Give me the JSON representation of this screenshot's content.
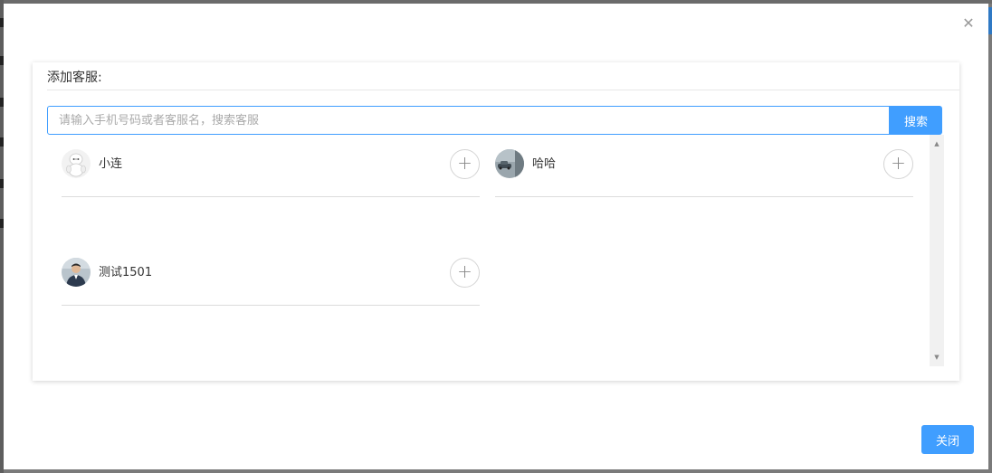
{
  "dialog": {
    "close_icon": "close-icon",
    "panel_title": "添加客服:",
    "search": {
      "placeholder": "请输入手机号码或者客服名，搜索客服",
      "value": "",
      "button_label": "搜索"
    },
    "agents": [
      {
        "name": "小连",
        "avatar": "robot-avatar",
        "add_icon": "plus-icon"
      },
      {
        "name": "哈哈",
        "avatar": "car-photo-avatar",
        "add_icon": "plus-icon"
      },
      {
        "name": "测试1501",
        "avatar": "person-photo-avatar",
        "add_icon": "plus-icon"
      }
    ],
    "footer": {
      "close_label": "关闭"
    }
  },
  "colors": {
    "primary": "#409eff",
    "overlay": "#7a7a7a",
    "divider": "#dcdcdc"
  }
}
